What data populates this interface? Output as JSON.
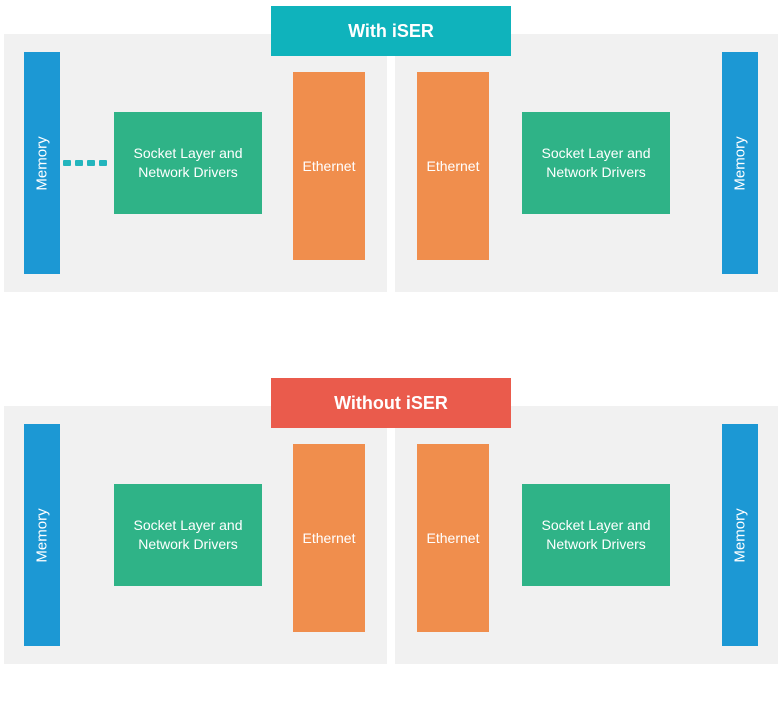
{
  "colors": {
    "with_header": "#0fb3bc",
    "without_header": "#ea5b4c",
    "panel_bg": "#f1f1f1",
    "memory": "#1c98d4",
    "socket": "#2fb387",
    "ethernet": "#f08e4d"
  },
  "sections": {
    "with": {
      "title": "With iSER",
      "left": {
        "memory": "Memory",
        "socket": "Socket Layer and Network Drivers",
        "ethernet": "Ethernet"
      },
      "right": {
        "ethernet": "Ethernet",
        "socket": "Socket Layer and Network Drivers",
        "memory": "Memory"
      }
    },
    "without": {
      "title": "Without iSER",
      "left": {
        "memory": "Memory",
        "socket": "Socket Layer and Network Drivers",
        "ethernet": "Ethernet"
      },
      "right": {
        "ethernet": "Ethernet",
        "socket": "Socket Layer and Network Drivers",
        "memory": "Memory"
      }
    }
  }
}
